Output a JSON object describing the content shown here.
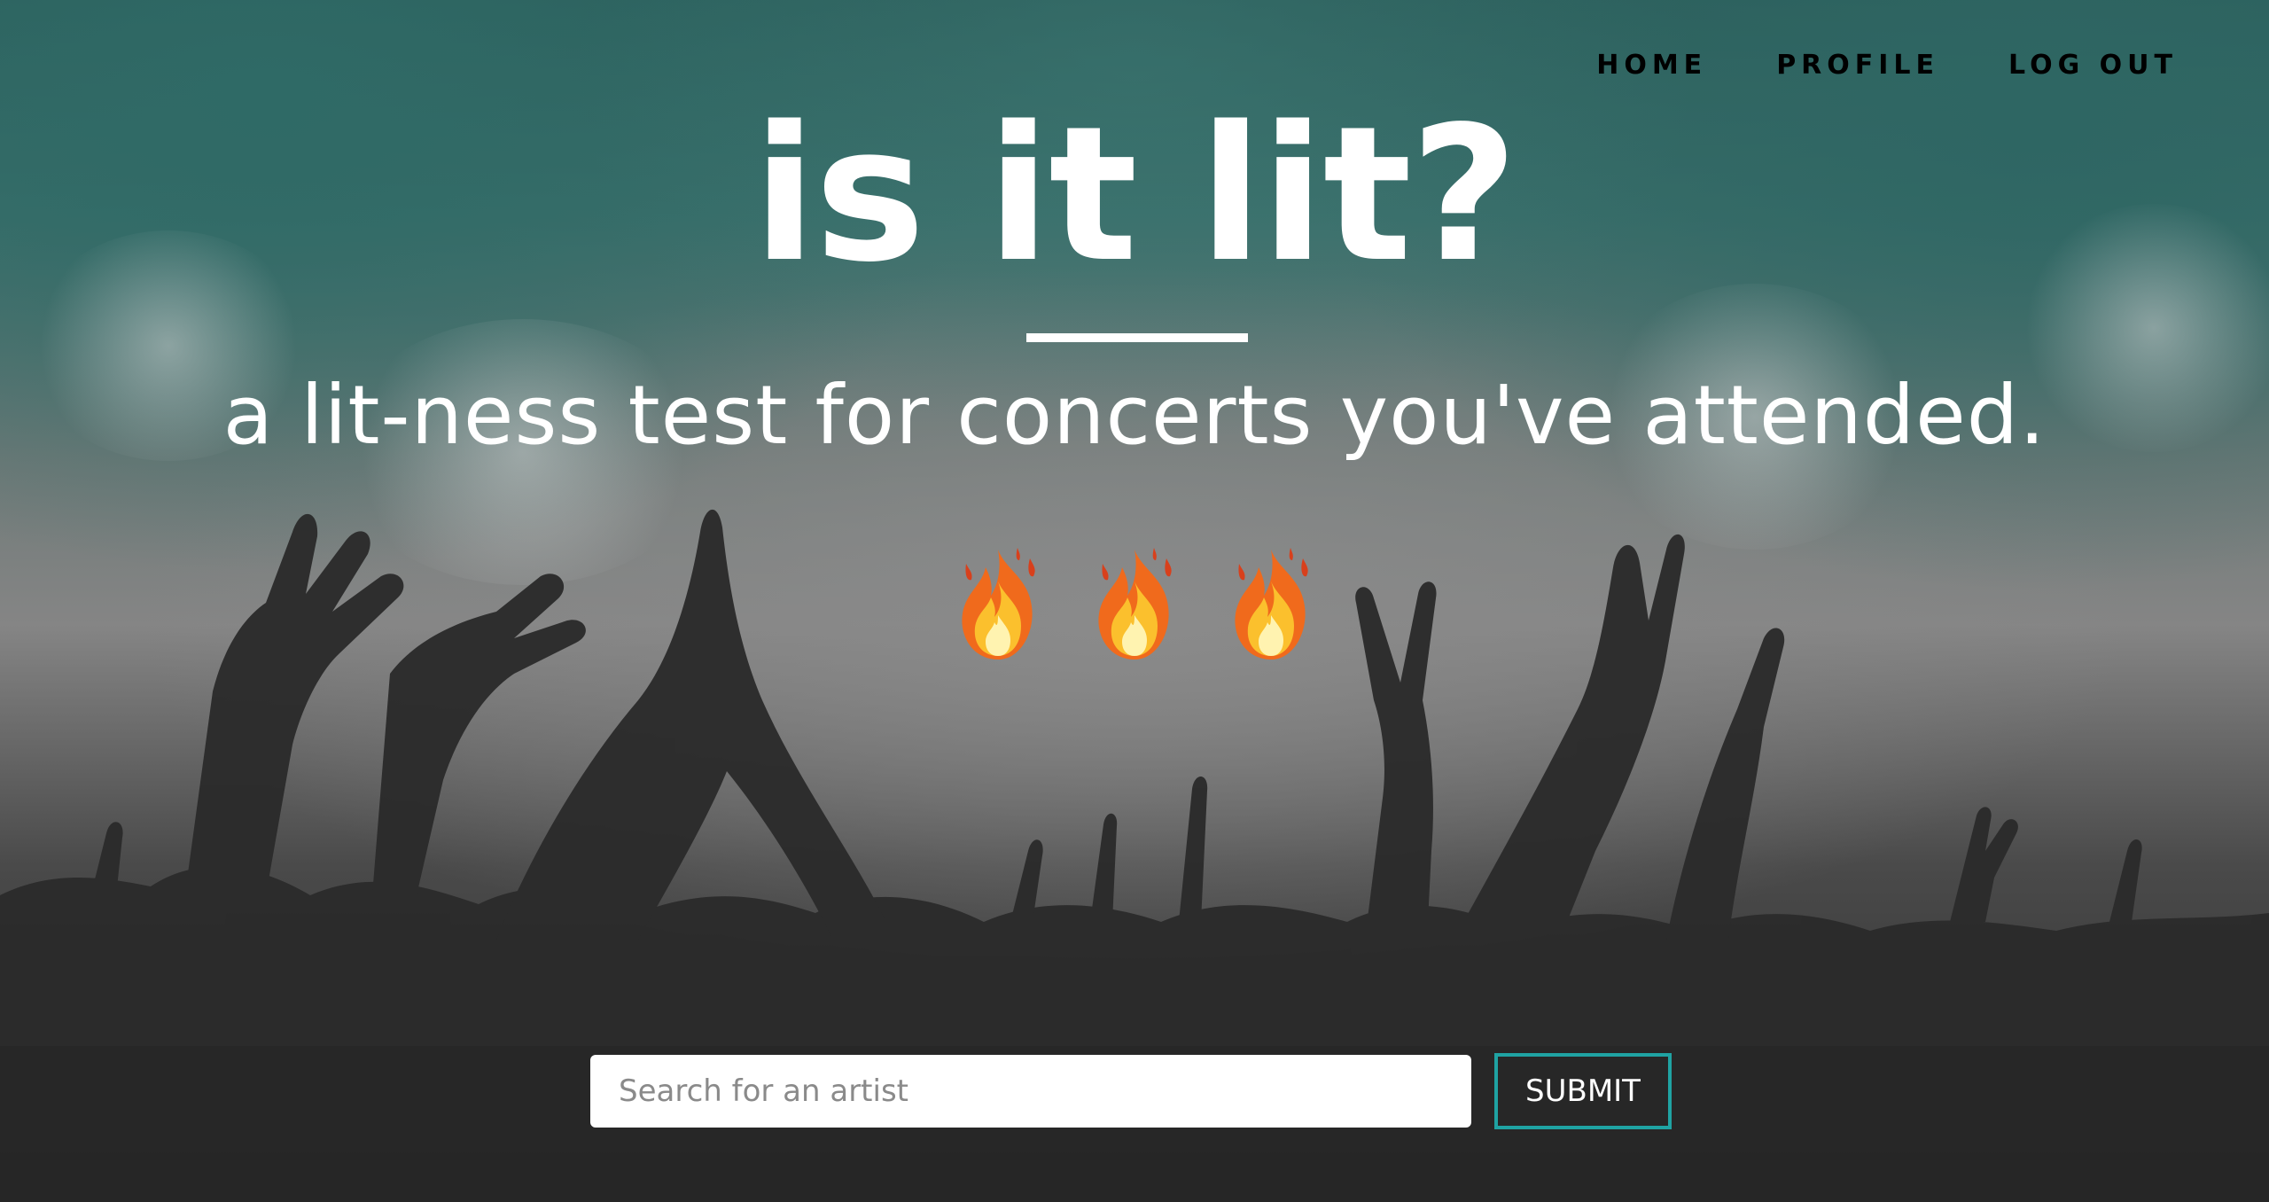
{
  "nav": {
    "items": [
      {
        "label": "HOME"
      },
      {
        "label": "PROFILE"
      },
      {
        "label": "LOG OUT"
      }
    ]
  },
  "hero": {
    "title": "is it lit?",
    "subtitle": "a lit-ness test for concerts you've attended.",
    "emoji_icons": [
      "fire-icon",
      "fire-icon",
      "fire-icon"
    ]
  },
  "search": {
    "placeholder": "Search for an artist",
    "value": "",
    "submit_label": "SUBMIT"
  },
  "colors": {
    "accent": "#1fa3a3",
    "teal_background": "#2f6a66",
    "text": "#ffffff",
    "nav_text": "#000000"
  }
}
